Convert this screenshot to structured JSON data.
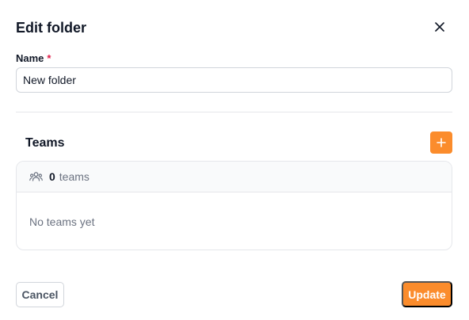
{
  "dialog": {
    "title": "Edit folder",
    "close_icon": "close-icon"
  },
  "name_field": {
    "label": "Name",
    "required_marker": "*",
    "value": "New folder"
  },
  "teams": {
    "heading": "Teams",
    "add_icon": "plus-icon",
    "header_icon": "users-icon",
    "count": "0",
    "count_unit": "teams",
    "empty_text": "No teams yet"
  },
  "footer": {
    "cancel_label": "Cancel",
    "update_label": "Update"
  },
  "colors": {
    "accent": "#fb8c2c",
    "required": "#e11d48"
  }
}
